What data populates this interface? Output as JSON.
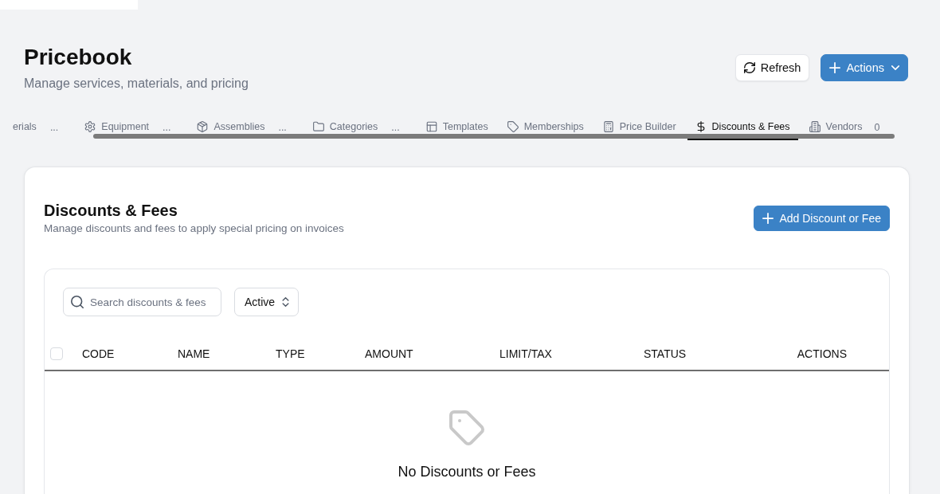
{
  "page": {
    "title": "Pricebook",
    "subtitle": "Manage services, materials, and pricing"
  },
  "header_buttons": [
    {
      "kind": "secondary",
      "label": "Refresh"
    },
    {
      "kind": "primary",
      "label": "Actions"
    }
  ],
  "tabs": [
    {
      "label": "erials",
      "more": "...",
      "selected": false
    },
    {
      "label": "Equipment",
      "more": "...",
      "selected": false
    },
    {
      "label": "Assemblies",
      "more": "...",
      "selected": false
    },
    {
      "label": "Categories",
      "more": "...",
      "selected": false
    },
    {
      "label": "Templates",
      "selected": false
    },
    {
      "label": "Memberships",
      "selected": false
    },
    {
      "label": "Price Builder",
      "selected": false
    },
    {
      "label": "Discounts & Fees",
      "selected": true
    },
    {
      "label": "Vendors",
      "count": "0",
      "selected": false
    }
  ],
  "section": {
    "title": "Discounts & Fees",
    "subtitle": "Manage discounts and fees to apply special pricing on invoices",
    "button": "Add Discount or Fee"
  },
  "filters": {
    "search": {
      "placeholder": "Search discounts & fees"
    },
    "status": {
      "value": "Active"
    }
  },
  "table": {
    "select_all": {
      "checked": false
    },
    "columns": [
      "CODE",
      "NAME",
      "TYPE",
      "AMOUNT",
      "LIMIT/TAX",
      "STATUS",
      "ACTIONS"
    ],
    "empty_state": {
      "title": "No Discounts or Fees"
    }
  }
}
